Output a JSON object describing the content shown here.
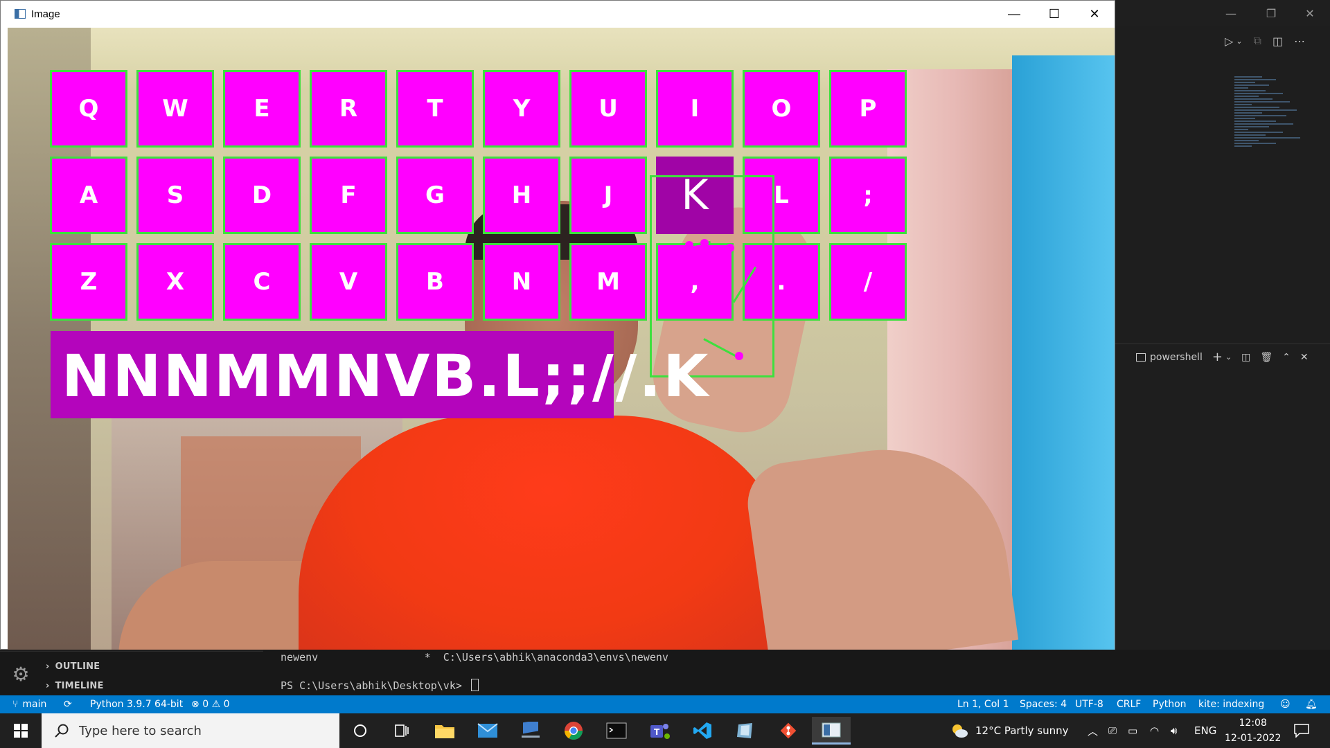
{
  "vscode": {
    "window_controls": [
      "—",
      "❐",
      "✕"
    ],
    "terminal_panel": {
      "shell_label": "powershell"
    },
    "sections": [
      {
        "label": "OUTLINE"
      },
      {
        "label": "TIMELINE"
      }
    ],
    "terminal_lines": [
      "newenv                 *  C:\\Users\\abhik\\anaconda3\\envs\\newenv",
      "PS C:\\Users\\abhik\\Desktop\\vk> "
    ],
    "statusbar": {
      "branch": "main",
      "python": "Python 3.9.7 64-bit",
      "errors": "0",
      "warnings": "0",
      "position": "Ln 1, Col 1",
      "spaces": "Spaces: 4",
      "encoding": "UTF-8",
      "eol": "CRLF",
      "language": "Python",
      "kite": "kite: indexing"
    }
  },
  "image_window": {
    "title": "Image",
    "controls": [
      "—",
      "☐",
      "✕"
    ],
    "keyboard_rows": [
      [
        "Q",
        "W",
        "E",
        "R",
        "T",
        "Y",
        "U",
        "I",
        "O",
        "P"
      ],
      [
        "A",
        "S",
        "D",
        "F",
        "G",
        "H",
        "J",
        "K",
        "L",
        ";"
      ],
      [
        "Z",
        "X",
        "C",
        "V",
        "B",
        "N",
        "M",
        ",",
        ".",
        "/"
      ]
    ],
    "pressed_key": "K",
    "typed_text": "NNNMMNVB.L;;//.K"
  },
  "taskbar": {
    "search_placeholder": "Type here to search",
    "weather": "12°C  Partly sunny",
    "language": "ENG",
    "time": "12:08",
    "date": "12-01-2022"
  }
}
